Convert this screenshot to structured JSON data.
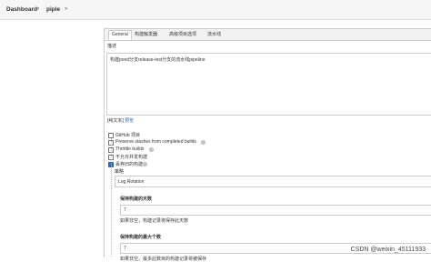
{
  "breadcrumbs": {
    "dashboard": "Dashboard",
    "sep1": "»",
    "job": "piple",
    "sep2": "»"
  },
  "tabs": [
    "General",
    "构建触发器",
    "高级项目选项",
    "流水线"
  ],
  "description": {
    "label": "描述",
    "value": "构建pond分支release-test分支的流水线pipeline",
    "plain_text": "[纯文本]",
    "preview": "预览"
  },
  "options": [
    {
      "label": "GitHub 项目",
      "checked": false
    },
    {
      "label": "Preserve stashes from completed builds",
      "checked": false,
      "help": "?"
    },
    {
      "label": "Throttle builds",
      "checked": false,
      "help": "?"
    },
    {
      "label": "不允许并发构建",
      "checked": false
    },
    {
      "label": "丢弃旧的构建",
      "checked": true,
      "help": "?"
    }
  ],
  "strategy": {
    "label": "策略",
    "value": "Log Rotation",
    "days_label": "保持构建的天数",
    "days_value": "7",
    "days_help": "如果非空，构建记录将保存此天数",
    "max_label": "保持构建的最大个数",
    "max_value": "7",
    "max_help": "如果非空，最多此数目的构建记录将被保存"
  },
  "watermark": "CSDN @weixin_45111933"
}
